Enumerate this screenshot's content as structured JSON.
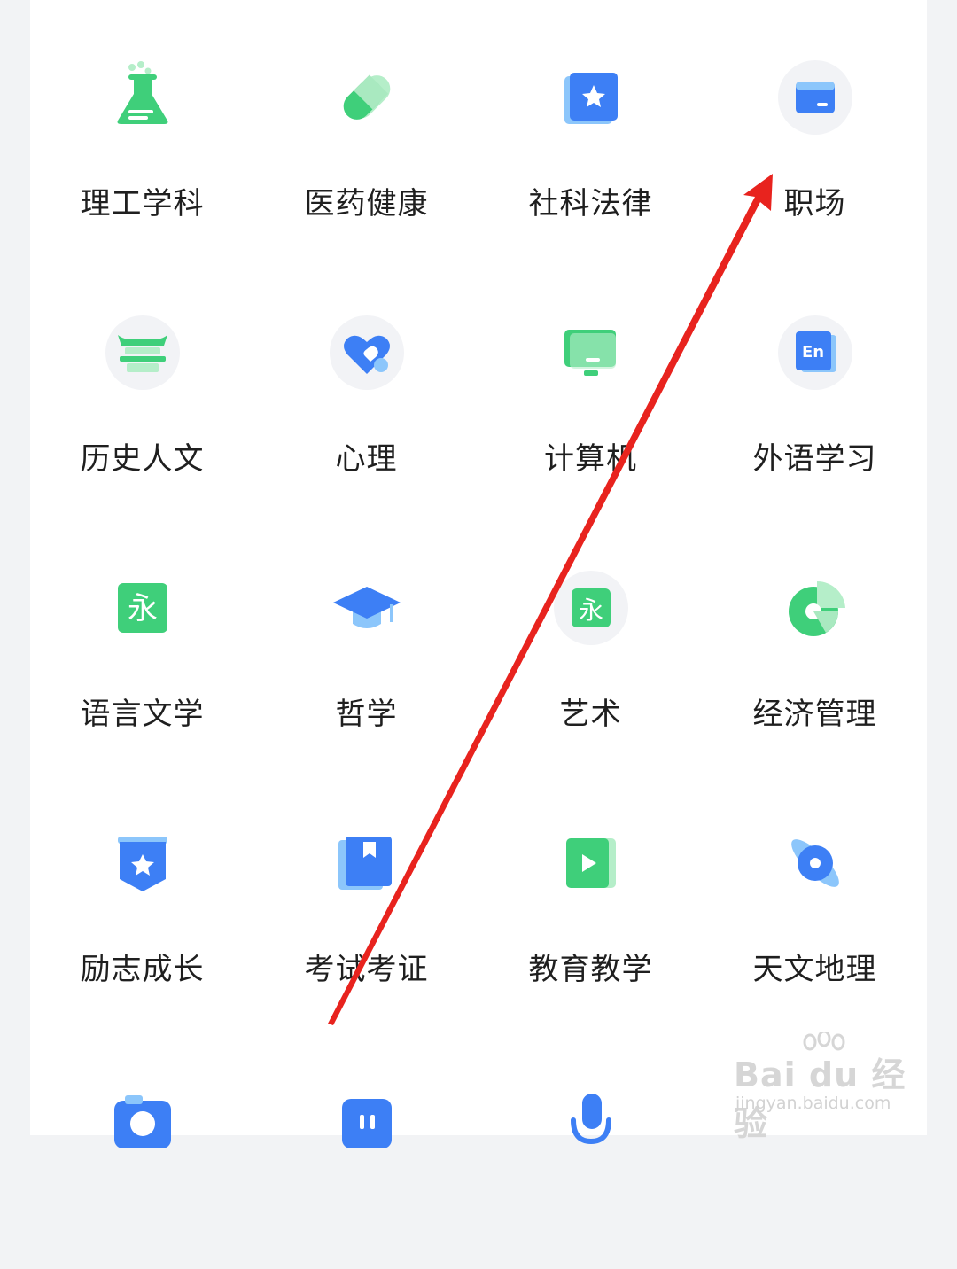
{
  "categories": [
    {
      "label": "理工学科",
      "icon": "flask-icon"
    },
    {
      "label": "医药健康",
      "icon": "pill-icon"
    },
    {
      "label": "社科法律",
      "icon": "star-card-icon"
    },
    {
      "label": "职场",
      "icon": "wallet-card-icon"
    },
    {
      "label": "历史人文",
      "icon": "pavilion-icon"
    },
    {
      "label": "心理",
      "icon": "heart-icon"
    },
    {
      "label": "计算机",
      "icon": "monitor-icon"
    },
    {
      "label": "外语学习",
      "icon": "english-book-icon"
    },
    {
      "label": "语言文学",
      "icon": "yong-character-icon",
      "glyph": "永"
    },
    {
      "label": "哲学",
      "icon": "graduation-cap-icon"
    },
    {
      "label": "艺术",
      "icon": "yong-character-icon",
      "glyph": "永"
    },
    {
      "label": "经济管理",
      "icon": "pie-chart-icon"
    },
    {
      "label": "励志成长",
      "icon": "star-badge-icon"
    },
    {
      "label": "考试考证",
      "icon": "bookmark-book-icon"
    },
    {
      "label": "教育教学",
      "icon": "video-play-icon"
    },
    {
      "label": "天文地理",
      "icon": "planet-icon"
    },
    {
      "label": "",
      "icon": "camera-icon"
    },
    {
      "label": "",
      "icon": "map-icon"
    },
    {
      "label": "",
      "icon": "microphone-icon"
    }
  ],
  "watermark": {
    "brand": "Bai du 经验",
    "url": "jingyan.baidu.com"
  },
  "colors": {
    "green": "#3fcf7a",
    "light_green": "#b5eec9",
    "blue": "#3d7ff5",
    "light_blue": "#8cc6fb",
    "circle_bg": "#f2f3f6",
    "arrow": "#e8231e"
  }
}
